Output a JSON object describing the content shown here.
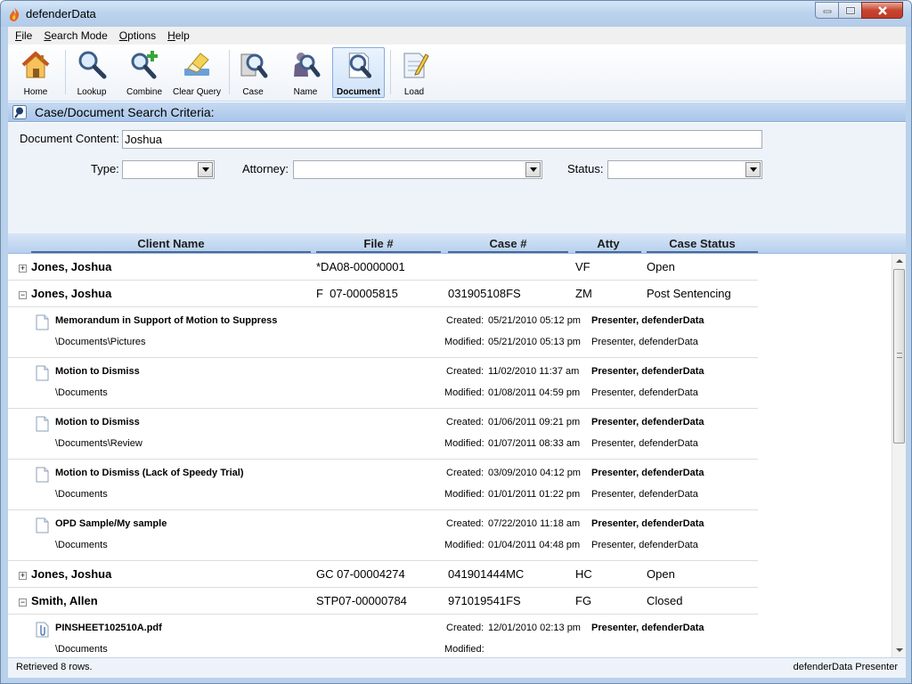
{
  "window": {
    "title": "defenderData"
  },
  "menu": [
    {
      "label": "File"
    },
    {
      "label": "Search Mode"
    },
    {
      "label": "Options"
    },
    {
      "label": "Help"
    }
  ],
  "toolbar": [
    {
      "label": "Home",
      "icon": "home-icon"
    },
    {
      "label": "Lookup",
      "icon": "magnifier-icon"
    },
    {
      "label": "Combine",
      "icon": "combine-icon"
    },
    {
      "label": "Clear Query",
      "icon": "eraser-icon"
    },
    {
      "label": "Case",
      "icon": "case-search-icon"
    },
    {
      "label": "Name",
      "icon": "name-search-icon"
    },
    {
      "label": "Document",
      "icon": "document-search-icon",
      "active": true
    },
    {
      "label": "Load",
      "icon": "load-icon"
    }
  ],
  "criteria": {
    "title": "Case/Document Search Criteria:",
    "document_content_label": "Document Content:",
    "document_content_value": "Joshua",
    "type_label": "Type:",
    "type_value": "",
    "attorney_label": "Attorney:",
    "attorney_value": "",
    "status_label": "Status:",
    "status_value": ""
  },
  "grid": {
    "columns": [
      "Client Name",
      "File #",
      "Case #",
      "Atty",
      "Case Status"
    ],
    "rows": [
      {
        "kind": "case",
        "expanded": false,
        "client": "Jones, Joshua",
        "file": "*DA08-00000001",
        "case": "",
        "atty": "VF",
        "status": "Open"
      },
      {
        "kind": "case",
        "expanded": true,
        "client": "Jones, Joshua",
        "file": "F  07-00005815",
        "case": "031905108FS",
        "atty": "ZM",
        "status": "Post Sentencing"
      },
      {
        "kind": "doc",
        "title": "Memorandum in Support of Motion to Suppress",
        "path": "\\Documents\\Pictures",
        "created_label": "Created:",
        "created": "05/21/2010 05:12 pm",
        "created_by": "Presenter, defenderData",
        "modified_label": "Modified:",
        "modified": "05/21/2010 05:13 pm",
        "modified_by": "Presenter, defenderData"
      },
      {
        "kind": "doc",
        "title": "Motion to Dismiss",
        "path": "\\Documents",
        "created_label": "Created:",
        "created": "11/02/2010 11:37 am",
        "created_by": "Presenter, defenderData",
        "modified_label": "Modified:",
        "modified": "01/08/2011 04:59 pm",
        "modified_by": "Presenter, defenderData"
      },
      {
        "kind": "doc",
        "title": "Motion to Dismiss",
        "path": "\\Documents\\Review",
        "created_label": "Created:",
        "created": "01/06/2011 09:21 pm",
        "created_by": "Presenter, defenderData",
        "modified_label": "Modified:",
        "modified": "01/07/2011 08:33 am",
        "modified_by": "Presenter, defenderData"
      },
      {
        "kind": "doc",
        "title": "Motion to Dismiss (Lack of Speedy Trial)",
        "path": "\\Documents",
        "created_label": "Created:",
        "created": "03/09/2010 04:12 pm",
        "created_by": "Presenter, defenderData",
        "modified_label": "Modified:",
        "modified": "01/01/2011 01:22 pm",
        "modified_by": "Presenter, defenderData"
      },
      {
        "kind": "doc",
        "title": "OPD Sample/My sample",
        "path": "\\Documents",
        "created_label": "Created:",
        "created": "07/22/2010 11:18 am",
        "created_by": "Presenter, defenderData",
        "modified_label": "Modified:",
        "modified": "01/04/2011 04:48 pm",
        "modified_by": "Presenter, defenderData"
      },
      {
        "kind": "case",
        "expanded": false,
        "client": "Jones, Joshua",
        "file": "GC 07-00004274",
        "case": "041901444MC",
        "atty": "HC",
        "status": "Open"
      },
      {
        "kind": "case",
        "expanded": true,
        "client": "Smith, Allen",
        "file": "STP07-00000784",
        "case": "971019541FS",
        "atty": "FG",
        "status": "Closed"
      },
      {
        "kind": "doc",
        "attachment": true,
        "title": "PINSHEET102510A.pdf",
        "path": "\\Documents",
        "created_label": "Created:",
        "created": "12/01/2010 02:13 pm",
        "created_by": "Presenter, defenderData",
        "modified_label": "Modified:",
        "modified": "",
        "modified_by": ""
      }
    ]
  },
  "status": {
    "left": "Retrieved 8 rows.",
    "right": "defenderData Presenter"
  }
}
